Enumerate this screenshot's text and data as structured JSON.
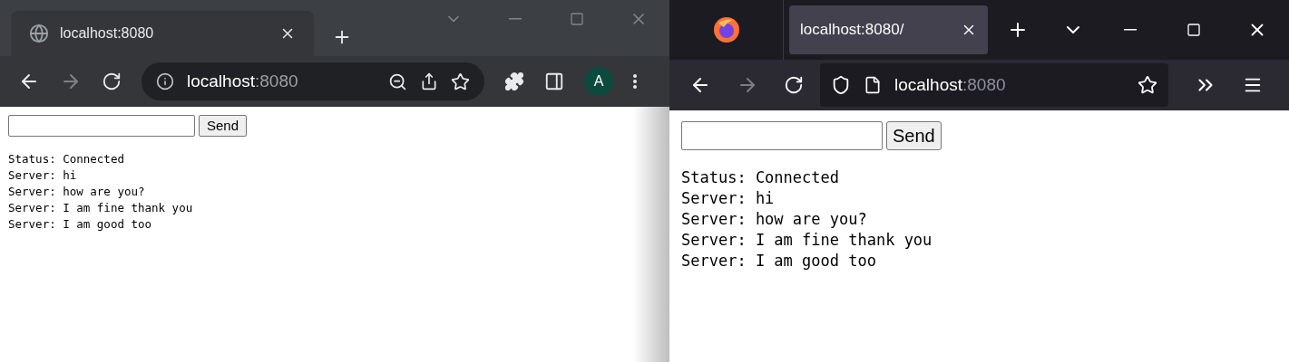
{
  "windows": [
    {
      "kind": "chrome",
      "tab": {
        "title": "localhost:8080",
        "selected": true
      },
      "forward": {
        "disabled": true
      },
      "address": {
        "host": "localhost",
        "port": ":8080"
      },
      "avatar": "A",
      "page": {
        "button": "Send",
        "log": [
          "Status: Connected",
          "Server: hi",
          "Server: how are you?",
          "Server: I am fine thank you",
          "Server: I am good too"
        ]
      }
    },
    {
      "kind": "firefox",
      "tab": {
        "title": "localhost:8080/",
        "selected": true
      },
      "forward": {
        "disabled": true
      },
      "address": {
        "host": "localhost",
        "port": ":8080"
      },
      "page": {
        "button": "Send",
        "log": [
          "Status: Connected",
          "Server: hi",
          "Server: how are you?",
          "Server: I am fine thank you",
          "Server: I am good too"
        ]
      }
    }
  ]
}
